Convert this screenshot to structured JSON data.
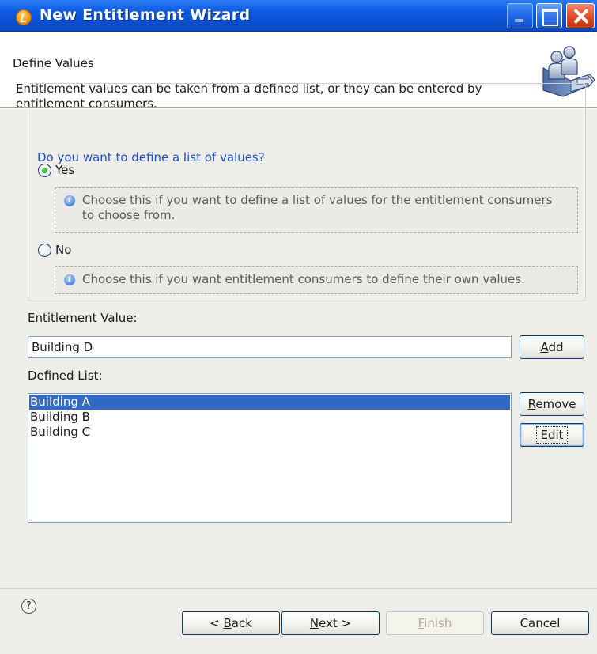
{
  "window": {
    "title": "New Entitlement Wizard"
  },
  "header": {
    "title": "Define Values",
    "description": "Entitlement values can be taken from a defined list, or they can be entered by entitlement consumers."
  },
  "question_group": {
    "legend": "Do you want to define a list of values?",
    "options": [
      {
        "label": "Yes",
        "checked": true,
        "hint": "Choose this if you want to define a list of values for the entitlement consumers to choose from."
      },
      {
        "label": "No",
        "checked": false,
        "hint": "Choose this if you want entitlement consumers to define their own values."
      }
    ]
  },
  "entitlement_value": {
    "label": "Entitlement Value:",
    "value": "Building D",
    "add_label_prefix": "",
    "add_label_accel": "A",
    "add_label_rest": "dd"
  },
  "defined_list": {
    "label": "Defined List:",
    "items": [
      {
        "text": "Building A",
        "selected": true
      },
      {
        "text": "Building B",
        "selected": false
      },
      {
        "text": "Building C",
        "selected": false
      }
    ],
    "remove_accel": "R",
    "remove_rest": "emove",
    "edit_accel": "E",
    "edit_rest": "dit"
  },
  "footer": {
    "help_symbol": "?",
    "back_prefix": "< ",
    "back_accel": "B",
    "back_rest": "ack",
    "next_accel": "N",
    "next_rest": "ext >",
    "finish_accel": "F",
    "finish_rest": "inish",
    "cancel_label": "Cancel"
  },
  "colors": {
    "titlebar": "#0a4fd1",
    "legend": "#1f4fc4",
    "selection": "#316ac5",
    "panel": "#efeeea"
  }
}
